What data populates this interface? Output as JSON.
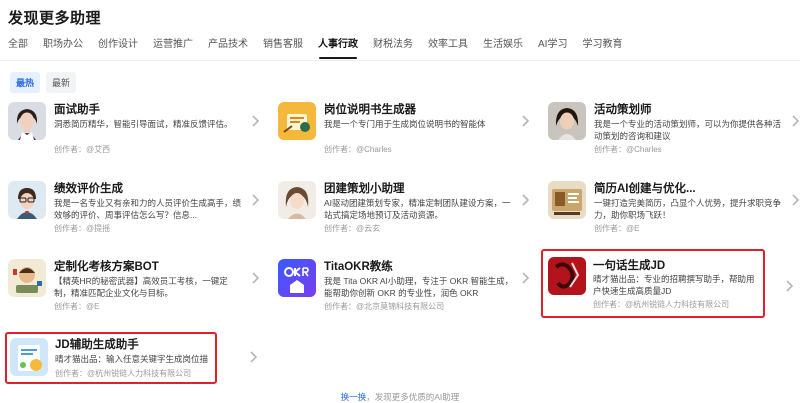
{
  "header": {
    "title": "发现更多助理"
  },
  "tabs": [
    {
      "label": "全部"
    },
    {
      "label": "职场办公"
    },
    {
      "label": "创作设计"
    },
    {
      "label": "运营推广"
    },
    {
      "label": "产品技术"
    },
    {
      "label": "销售客服"
    },
    {
      "label": "人事行政"
    },
    {
      "label": "财税法务"
    },
    {
      "label": "效率工具"
    },
    {
      "label": "生活娱乐"
    },
    {
      "label": "AI学习"
    },
    {
      "label": "学习教育"
    }
  ],
  "active_tab": "人事行政",
  "filters": [
    {
      "label": "最热"
    },
    {
      "label": "最新"
    }
  ],
  "cards": [
    {
      "title": "面试助手",
      "desc": "洞悉简历精华，智能引导面试，精准反馈评估。",
      "author": "创作者：@艾西"
    },
    {
      "title": "岗位说明书生成器",
      "desc": "我是一个专门用于生成岗位说明书的智能体",
      "author": "创作者：@Charles"
    },
    {
      "title": "活动策划师",
      "desc": "我是一个专业的活动策划师，可以为你提供各种活动策划的咨询和建议",
      "author": "创作者：@Charles"
    },
    {
      "title": "绩效评价生成",
      "desc": "我是一名专业又有亲和力的人员评价生成高手，绩效够的评价、周事评估怎么写？信息...",
      "author": "创作者：@提摇"
    },
    {
      "title": "团建策划小助理",
      "desc": "AI驱动团建策划专家，精准定制团队建设方案，一站式搞定场地预订及活动资源。",
      "author": "创作者：@云玄"
    },
    {
      "title": "简历AI创建与优化...",
      "desc": "一键打造完美简历，凸显个人优势，提升求职竞争力，助你职场飞跃！",
      "author": "创作者：@E"
    },
    {
      "title": "定制化考核方案BOT",
      "desc": "【精英HR的秘密武器】高效员工考核，一键定制，精准匹配企业文化与目标。",
      "author": "创作者：@E"
    },
    {
      "title": "TitaOKR教练",
      "desc": "我是 Tita OKR AI小助理，专注于 OKR 智能生成，能帮助你创新 OKR 的专业性，润色 OKR",
      "author": "创作者：@北京莫锦科技有限公司"
    },
    {
      "title": "一句话生成JD",
      "desc": "晴才猫出品：专业的招聘撰写助手，帮助用户快速生成高质量JD",
      "author": "创作者：@杭州锐链人力科技有限公司"
    },
    {
      "title": "JD辅助生成助手",
      "desc": "晴才猫出品：输入任意关键字生成岗位描述。",
      "author": "创作者：@杭州锐链人力科技有限公司"
    }
  ],
  "footer": {
    "link": "换一换",
    "text": "，发现更多优质的AI助理"
  },
  "colors": {
    "accent": "#2b6de5",
    "highlight_border": "#e0202a"
  },
  "icons": [
    "chevron-right-icon"
  ]
}
